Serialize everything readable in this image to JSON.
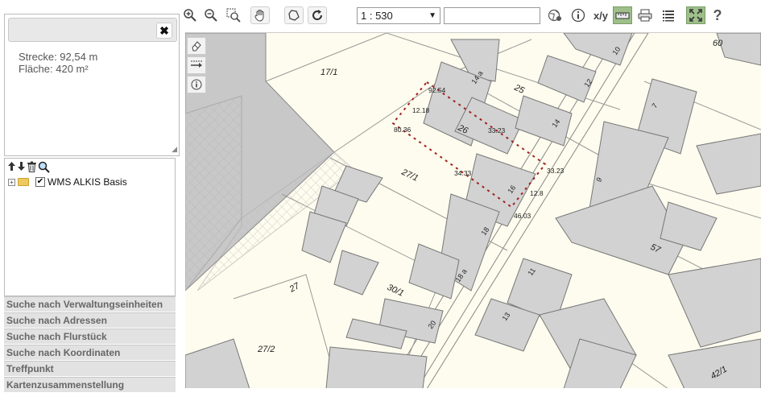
{
  "toolbar": {
    "scale_value": "1 : 530",
    "scale_arrow": "▼",
    "xy_label": "x/y",
    "help_label": "?",
    "icons": [
      "zoom-in-icon",
      "zoom-out-icon",
      "zoom-box-icon",
      "pan-hand-icon",
      "polygon-icon",
      "refresh-icon",
      "globe-icon",
      "info-icon",
      "ruler-icon",
      "print-icon",
      "list-icon",
      "fullscreen-icon",
      "help-icon"
    ]
  },
  "measure": {
    "close": "✖",
    "strecke": "Strecke: 92,54 m",
    "flaeche": "Fläche: 420 m²"
  },
  "layers": {
    "plus": "+",
    "check": "✔",
    "name": "WMS ALKIS Basis"
  },
  "accordion": [
    "Suche nach Verwaltungseinheiten",
    "Suche nach Adressen",
    "Suche nach Flurstück",
    "Suche nach Koordinaten",
    "Treffpunkt",
    "Kartenzusammenstellung"
  ],
  "map": {
    "parcels": [
      "17/1",
      "25",
      "26",
      "27/1",
      "27",
      "30/1",
      "27/2",
      "57",
      "60",
      "42/1"
    ],
    "houses": [
      "10",
      "12",
      "14",
      "14 a",
      "16",
      "18",
      "18 a",
      "20",
      "11",
      "13",
      "9",
      "7"
    ],
    "measurements": [
      "92.54",
      "12.18",
      "80.36",
      "33.23",
      "33.23",
      "34.33",
      "12.8",
      "46.03"
    ]
  }
}
